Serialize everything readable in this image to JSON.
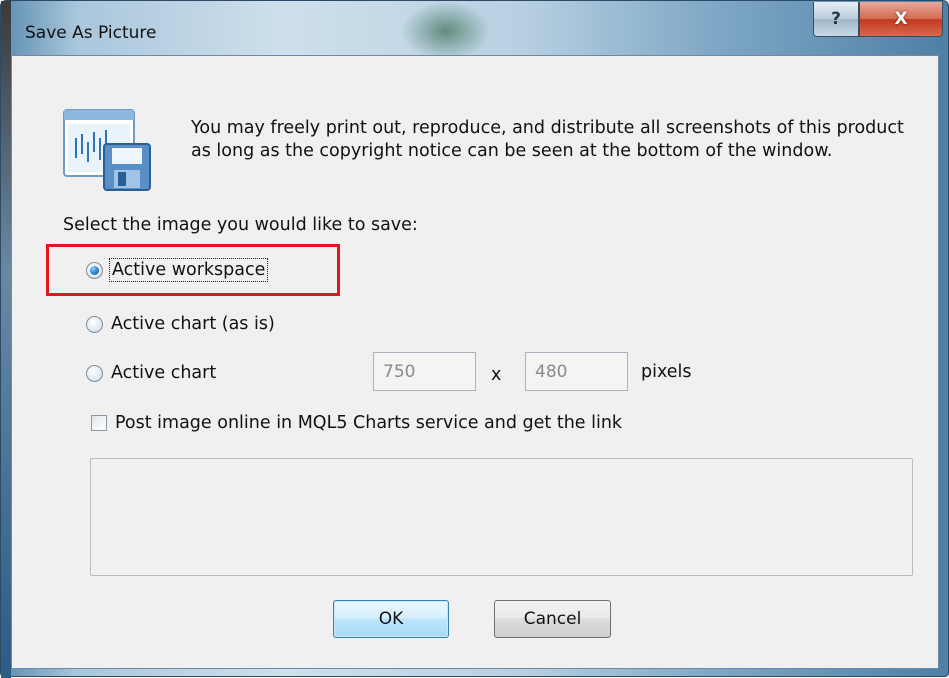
{
  "window": {
    "title": "Save As Picture",
    "help_label": "?",
    "close_label": "X"
  },
  "notice": "You may freely print out, reproduce, and distribute all screenshots of this product as long as the copyright notice can be seen at the bottom of the window.",
  "prompt": "Select the image you would like to save:",
  "options": [
    {
      "label": "Active workspace",
      "checked": true
    },
    {
      "label": "Active chart (as is)",
      "checked": false
    },
    {
      "label": "Active chart",
      "checked": false
    }
  ],
  "size": {
    "width_value": "750",
    "times_label": "x",
    "height_value": "480",
    "unit_label": "pixels"
  },
  "post_online": {
    "label": "Post image online in MQL5 Charts service and get the link",
    "checked": false
  },
  "link_box_value": "",
  "buttons": {
    "ok_label": "OK",
    "cancel_label": "Cancel"
  },
  "colors": {
    "highlight": "#e6151d",
    "default_button_border": "#3c7fb1"
  },
  "icons": {
    "app": "chart-save-icon"
  }
}
